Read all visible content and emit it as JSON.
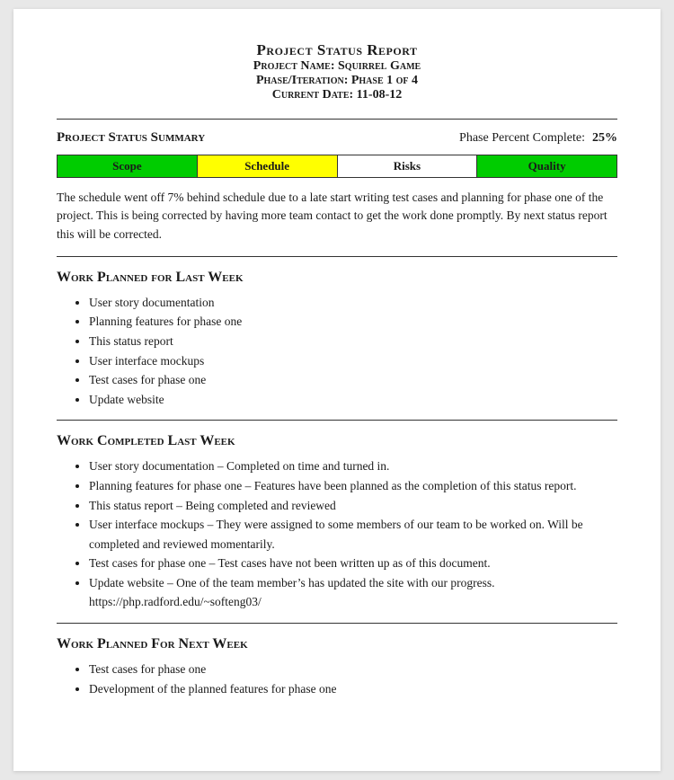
{
  "header": {
    "title": "Project Status Report",
    "project_name_label": "Project Name: Squirrel Game",
    "phase_label": "Phase/Iteration: Phase 1 of 4",
    "date_label": "Current Date: 11-08-12"
  },
  "status_summary": {
    "label": "Project Status Summary",
    "phase_percent_label": "Phase Percent Complete:",
    "phase_percent_value": "25%"
  },
  "status_bar": {
    "scope": "Scope",
    "schedule": "Schedule",
    "risks": "Risks",
    "quality": "Quality"
  },
  "summary_text": "The schedule went off 7% behind schedule due to a late start writing test cases and planning for phase one of the project. This is being corrected by having more team contact to get the work done promptly. By next status report this will be corrected.",
  "work_planned_last_week": {
    "heading": "Work Planned for Last Week",
    "items": [
      "User story documentation",
      "Planning features for phase one",
      "This status report",
      "User interface mockups",
      "Test cases for phase one",
      "Update website"
    ]
  },
  "work_completed_last_week": {
    "heading": "Work Completed Last Week",
    "items": [
      "User story documentation – Completed on time and turned in.",
      "Planning features for phase one – Features have been planned as the completion of this status report.",
      "This status report – Being completed and reviewed",
      "User interface mockups – They were assigned to some members of our team to be worked on. Will be completed and reviewed momentarily.",
      "Test cases for phase one – Test cases have not been written up as of this document.",
      "Update website – One of the team member’s has updated the site with our progress. https://php.radford.edu/~softeng03/"
    ]
  },
  "work_planned_next_week": {
    "heading": "Work Planned For Next Week",
    "items": [
      "Test cases for phase one",
      "Development of the planned features for phase one"
    ]
  }
}
